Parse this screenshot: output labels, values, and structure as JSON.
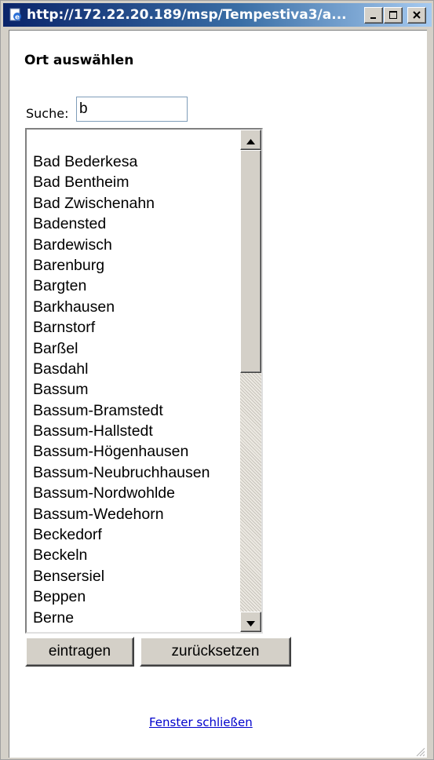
{
  "window": {
    "title": "http://172.22.20.189/msp/Tempestiva3/a..."
  },
  "page": {
    "heading": "Ort auswählen",
    "search": {
      "label": "Suche:",
      "value": "b"
    },
    "list": {
      "items": [
        "Bad Bederkesa",
        "Bad Bentheim",
        "Bad Zwischenahn",
        "Badensted",
        "Bardewisch",
        "Barenburg",
        "Bargten",
        "Barkhausen",
        "Barnstorf",
        "Barßel",
        "Basdahl",
        "Bassum",
        "Bassum-Bramstedt",
        "Bassum-Hallstedt",
        "Bassum-Högenhausen",
        "Bassum-Neubruchhausen",
        "Bassum-Nordwohlde",
        "Bassum-Wedehorn",
        "Beckedorf",
        "Beckeln",
        "Bensersiel",
        "Beppen",
        "Berne"
      ]
    },
    "buttons": {
      "submit": "eintragen",
      "reset": "zurücksetzen"
    },
    "close_link": "Fenster schließen"
  },
  "icons": {
    "title": "ie-page-icon",
    "minimize": "minimize-icon",
    "maximize": "maximize-icon",
    "close": "close-icon",
    "scroll_up": "arrow-up-icon",
    "scroll_down": "arrow-down-icon"
  },
  "colors": {
    "titlebar": "#0a246a",
    "link": "#0000cc",
    "face": "#d4d0c8"
  }
}
